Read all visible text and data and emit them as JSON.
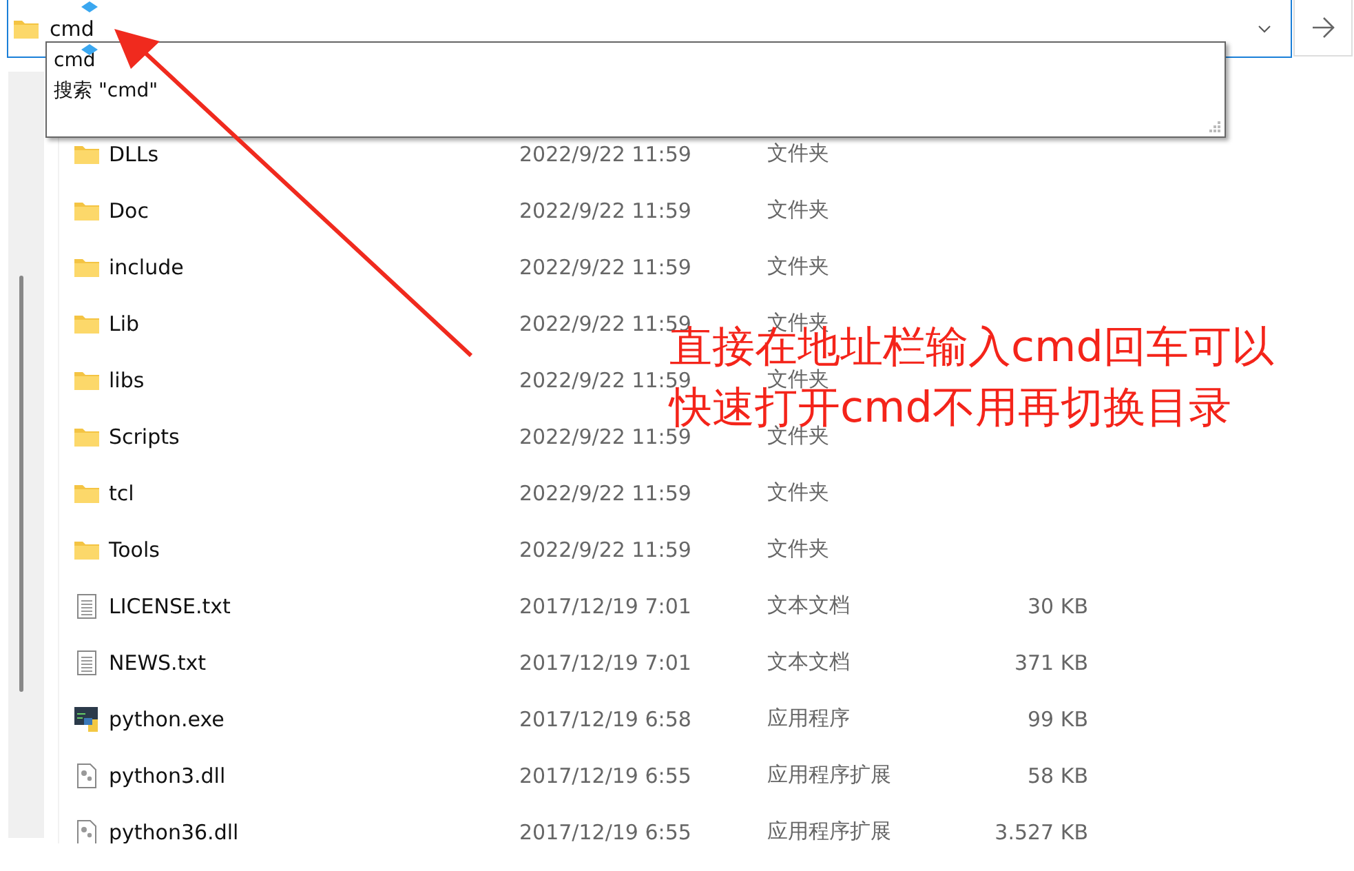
{
  "address_bar": {
    "value": "cmd"
  },
  "suggestions": [
    "cmd",
    "搜索 \"cmd\""
  ],
  "files": [
    {
      "kind": "folder",
      "name": "DLLs",
      "date": "2022/9/22 11:59",
      "type": "文件夹"
    },
    {
      "kind": "folder",
      "name": "Doc",
      "date": "2022/9/22 11:59",
      "type": "文件夹"
    },
    {
      "kind": "folder",
      "name": "include",
      "date": "2022/9/22 11:59",
      "type": "文件夹"
    },
    {
      "kind": "folder",
      "name": "Lib",
      "date": "2022/9/22 11:59",
      "type": "文件夹"
    },
    {
      "kind": "folder",
      "name": "libs",
      "date": "2022/9/22 11:59",
      "type": "文件夹"
    },
    {
      "kind": "folder",
      "name": "Scripts",
      "date": "2022/9/22 11:59",
      "type": "文件夹"
    },
    {
      "kind": "folder",
      "name": "tcl",
      "date": "2022/9/22 11:59",
      "type": "文件夹"
    },
    {
      "kind": "folder",
      "name": "Tools",
      "date": "2022/9/22 11:59",
      "type": "文件夹"
    },
    {
      "kind": "text",
      "name": "LICENSE.txt",
      "date": "2017/12/19 7:01",
      "type": "文本文档",
      "size": "30 KB"
    },
    {
      "kind": "text",
      "name": "NEWS.txt",
      "date": "2017/12/19 7:01",
      "type": "文本文档",
      "size": "371 KB"
    },
    {
      "kind": "exe",
      "name": "python.exe",
      "date": "2017/12/19 6:58",
      "type": "应用程序",
      "size": "99 KB"
    },
    {
      "kind": "dll",
      "name": "python3.dll",
      "date": "2017/12/19 6:55",
      "type": "应用程序扩展",
      "size": "58 KB"
    },
    {
      "kind": "dll",
      "name": "python36.dll",
      "date": "2017/12/19 6:55",
      "type": "应用程序扩展",
      "size": "3.527 KB"
    }
  ],
  "annotation": [
    "直接在地址栏输入cmd回车可以",
    "快速打开cmd不用再切换目录"
  ]
}
